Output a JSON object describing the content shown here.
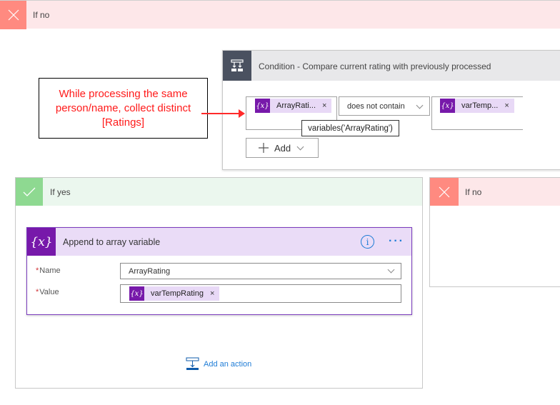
{
  "top_branch": {
    "label": "If no",
    "icon": "close-icon"
  },
  "condition": {
    "title": "Condition - Compare current rating with previously processed",
    "icon": "condition-icon",
    "left_operand": {
      "token_label": "ArrayRati...",
      "token_icon": "variable-icon",
      "remove": "×"
    },
    "operator": {
      "selected": "does not contain"
    },
    "right_operand": {
      "token_label": "varTemp...",
      "token_icon": "variable-icon",
      "remove": "×"
    },
    "tooltip": "variables('ArrayRating')",
    "add_button": {
      "label": "Add",
      "icon": "plus-icon"
    }
  },
  "annotation": {
    "text": "While processing the same person/name, collect distinct [Ratings]",
    "color": "#ff1a1a"
  },
  "yes_branch": {
    "label": "If yes",
    "icon": "check-icon",
    "action": {
      "title": "Append to array variable",
      "icon": "variable-icon",
      "icon_text": "{x}",
      "info_icon": "i",
      "more_icon": "···",
      "fields": [
        {
          "label": "Name",
          "required": "*",
          "value": "ArrayRating"
        },
        {
          "label": "Value",
          "required": "*",
          "token_label": "varTempRating",
          "remove": "×"
        }
      ]
    },
    "add_action_label": "Add an action"
  },
  "no_branch": {
    "label": "If no",
    "icon": "close-icon"
  },
  "colors": {
    "no_accent": "#ff8a80",
    "yes_accent": "#8ed991",
    "variable_purple": "#7719aa",
    "link_blue": "#1e7cd6"
  }
}
